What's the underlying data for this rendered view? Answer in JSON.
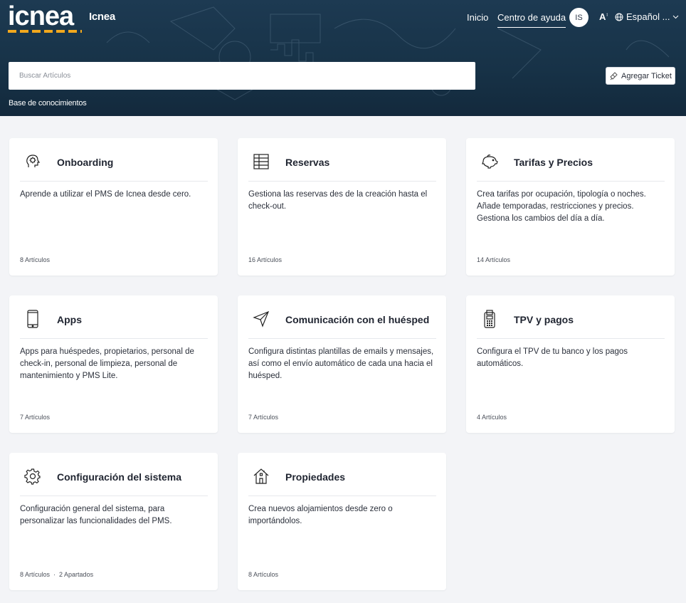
{
  "header": {
    "logo_text": "icnea",
    "brand_name": "Icnea",
    "nav": {
      "home": "Inicio",
      "help_center": "Centro de ayuda"
    },
    "user_initials": "IS",
    "font_toggle": "A",
    "language": "Español ..."
  },
  "search": {
    "placeholder": "Buscar Artículos",
    "add_ticket": "Agregar Ticket"
  },
  "breadcrumb": "Base de conocimientos",
  "categories": [
    {
      "title": "Onboarding",
      "icon": "head-gear-icon",
      "description": "Aprende a utilizar el PMS de Icnea desde cero.",
      "articles": "8 Artículos",
      "sections": ""
    },
    {
      "title": "Reservas",
      "icon": "grid-table-icon",
      "description": "Gestiona las reservas des de la creación hasta el check-out.",
      "articles": "16 Artículos",
      "sections": ""
    },
    {
      "title": "Tarifas y Precios",
      "icon": "piggy-bank-icon",
      "description": "Crea tarifas por ocupación, tipología o noches. Añade temporadas, restricciones y precios. Gestiona los cambios del día a día.",
      "articles": "14 Artículos",
      "sections": ""
    },
    {
      "title": "Apps",
      "icon": "smartphone-icon",
      "description": "Apps para huéspedes, propietarios, personal de check-in, personal de limpieza, personal de mantenimiento y PMS Lite.",
      "articles": "7 Artículos",
      "sections": ""
    },
    {
      "title": "Comunicación con el huésped",
      "icon": "paper-plane-icon",
      "description": "Configura distintas plantillas de emails y mensajes, así como el envío automático de cada una hacia el huésped.",
      "articles": "7 Artículos",
      "sections": ""
    },
    {
      "title": "TPV y pagos",
      "icon": "pos-terminal-icon",
      "description": "Configura el TPV de tu banco y los pagos automáticos.",
      "articles": "4 Artículos",
      "sections": ""
    },
    {
      "title": "Configuración del sistema",
      "icon": "gear-icon",
      "description": "Configuración general del sistema, para personalizar las funcionalidades del PMS.",
      "articles": "8 Artículos",
      "sections": "2 Apartados"
    },
    {
      "title": "Propiedades",
      "icon": "house-icon",
      "description": "Crea nuevos alojamientos desde zero o importándolos.",
      "articles": "8 Artículos",
      "sections": ""
    }
  ],
  "colors": {
    "hero": "#173247",
    "logo_accent": "#f2a81d",
    "page_bg": "#f3f4f7",
    "card_bg": "#ffffff"
  }
}
